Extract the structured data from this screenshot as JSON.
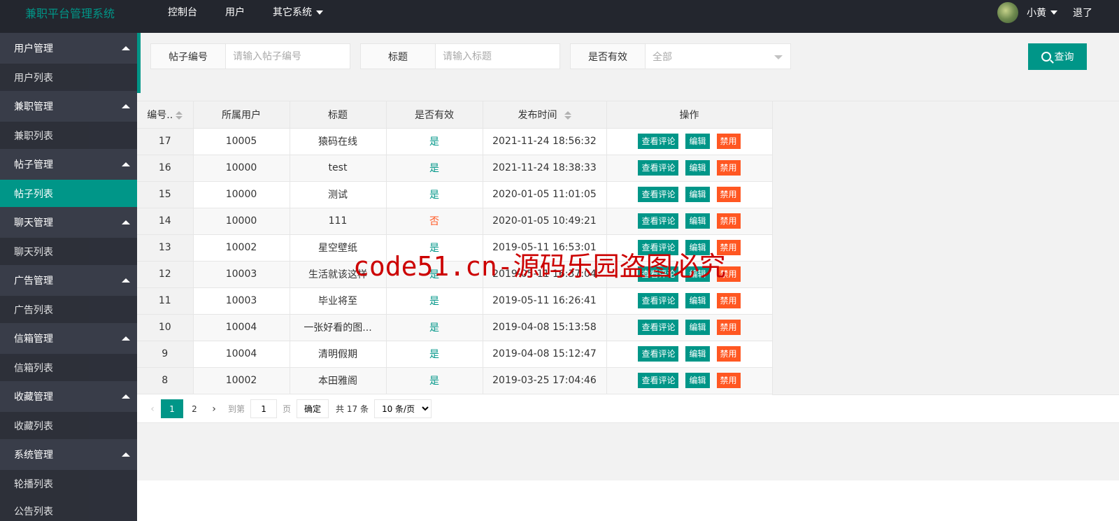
{
  "header": {
    "logo": "兼职平台管理系统",
    "nav": [
      "控制台",
      "用户",
      "其它系统"
    ],
    "user_name": "小黄",
    "logout": "退了"
  },
  "sidebar": [
    {
      "title": "用户管理",
      "sub": "用户列表"
    },
    {
      "title": "兼职管理",
      "sub": "兼职列表"
    },
    {
      "title": "帖子管理",
      "sub": "帖子列表"
    },
    {
      "title": "聊天管理",
      "sub": "聊天列表"
    },
    {
      "title": "广告管理",
      "sub": "广告列表"
    },
    {
      "title": "信箱管理",
      "sub": "信箱列表"
    },
    {
      "title": "收藏管理",
      "sub": "收藏列表"
    },
    {
      "title": "系统管理",
      "sub": "轮播列表"
    },
    {
      "title": "",
      "sub": "公告列表"
    }
  ],
  "search": {
    "post_id_label": "帖子编号",
    "post_id_placeholder": "请输入帖子编号",
    "title_label": "标题",
    "title_placeholder": "请输入标题",
    "valid_label": "是否有效",
    "valid_value": "全部",
    "query_button": "查询"
  },
  "table": {
    "headers": [
      "编号..",
      "所属用户",
      "标题",
      "是否有效",
      "发布时间",
      "操作"
    ],
    "rows": [
      {
        "id": "17",
        "user": "10005",
        "title": "猿码在线",
        "valid": "是",
        "time": "2021-11-24 18:56:32"
      },
      {
        "id": "16",
        "user": "10000",
        "title": "test",
        "valid": "是",
        "time": "2021-11-24 18:38:33"
      },
      {
        "id": "15",
        "user": "10000",
        "title": "测试",
        "valid": "是",
        "time": "2020-01-05 11:01:05"
      },
      {
        "id": "14",
        "user": "10000",
        "title": "111",
        "valid": "否",
        "time": "2020-01-05 10:49:21"
      },
      {
        "id": "13",
        "user": "10002",
        "title": "星空壁纸",
        "valid": "是",
        "time": "2019-05-11 16:53:01"
      },
      {
        "id": "12",
        "user": "10003",
        "title": "生活就该这样",
        "valid": "是",
        "time": "2019-05-11 16:37:04"
      },
      {
        "id": "11",
        "user": "10003",
        "title": "毕业将至",
        "valid": "是",
        "time": "2019-05-11 16:26:41"
      },
      {
        "id": "10",
        "user": "10004",
        "title": "一张好看的图...",
        "valid": "是",
        "time": "2019-04-08 15:13:58"
      },
      {
        "id": "9",
        "user": "10004",
        "title": "清明假期",
        "valid": "是",
        "time": "2019-04-08 15:12:47"
      },
      {
        "id": "8",
        "user": "10002",
        "title": "本田雅阁",
        "valid": "是",
        "time": "2019-03-25 17:04:46"
      }
    ],
    "actions": [
      "查看评论",
      "编辑",
      "禁用"
    ]
  },
  "pager": {
    "pages": [
      "1",
      "2"
    ],
    "goto_label": "到第",
    "goto_value": "1",
    "page_unit": "页",
    "confirm": "确定",
    "total": "共 17 条",
    "page_size": "10 条/页"
  },
  "watermark": "code51.cn-源码乐园盗图必究",
  "colors": {
    "accent": "#009688",
    "danger": "#ff5722",
    "header_bg": "#23262e",
    "sidebar_bg": "#393d49"
  }
}
